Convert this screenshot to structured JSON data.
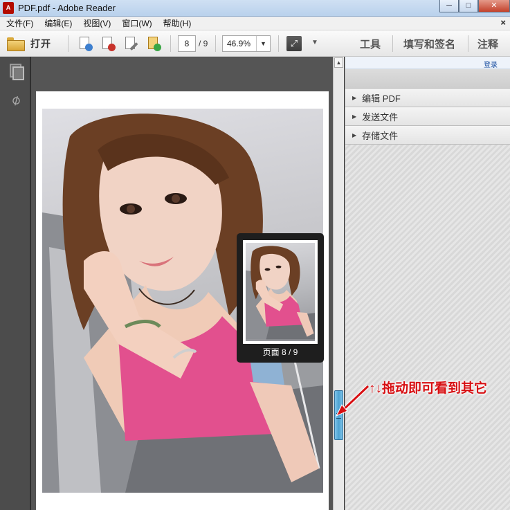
{
  "window": {
    "title": "PDF.pdf - Adobe Reader",
    "minimize": "─",
    "maximize": "□",
    "close": "✕"
  },
  "menu": {
    "items": [
      "文件(F)",
      "编辑(E)",
      "视图(V)",
      "窗口(W)",
      "帮助(H)"
    ],
    "close": "×"
  },
  "toolbar": {
    "open_label": "打开",
    "page_current": "8",
    "page_total": "/ 9",
    "zoom": "46.9%",
    "zoom_dropdown": "▼",
    "more": "▼",
    "tools": "工具",
    "fill_sign": "填写和签名",
    "comment": "注释",
    "icons": [
      "create-pdf-icon",
      "convert-icon",
      "edit-icon",
      "share-icon"
    ]
  },
  "right_panel": {
    "login": "登录",
    "sections": [
      "编辑 PDF",
      "发送文件",
      "存储文件"
    ]
  },
  "thumbnail": {
    "caption": "页面 8 / 9"
  },
  "annotation": {
    "text": "↑↓拖动即可看到其它"
  },
  "colors": {
    "accent_red": "#d70f12",
    "scroll_thumb": "#4ea3d2",
    "doc_background": "#555555"
  }
}
